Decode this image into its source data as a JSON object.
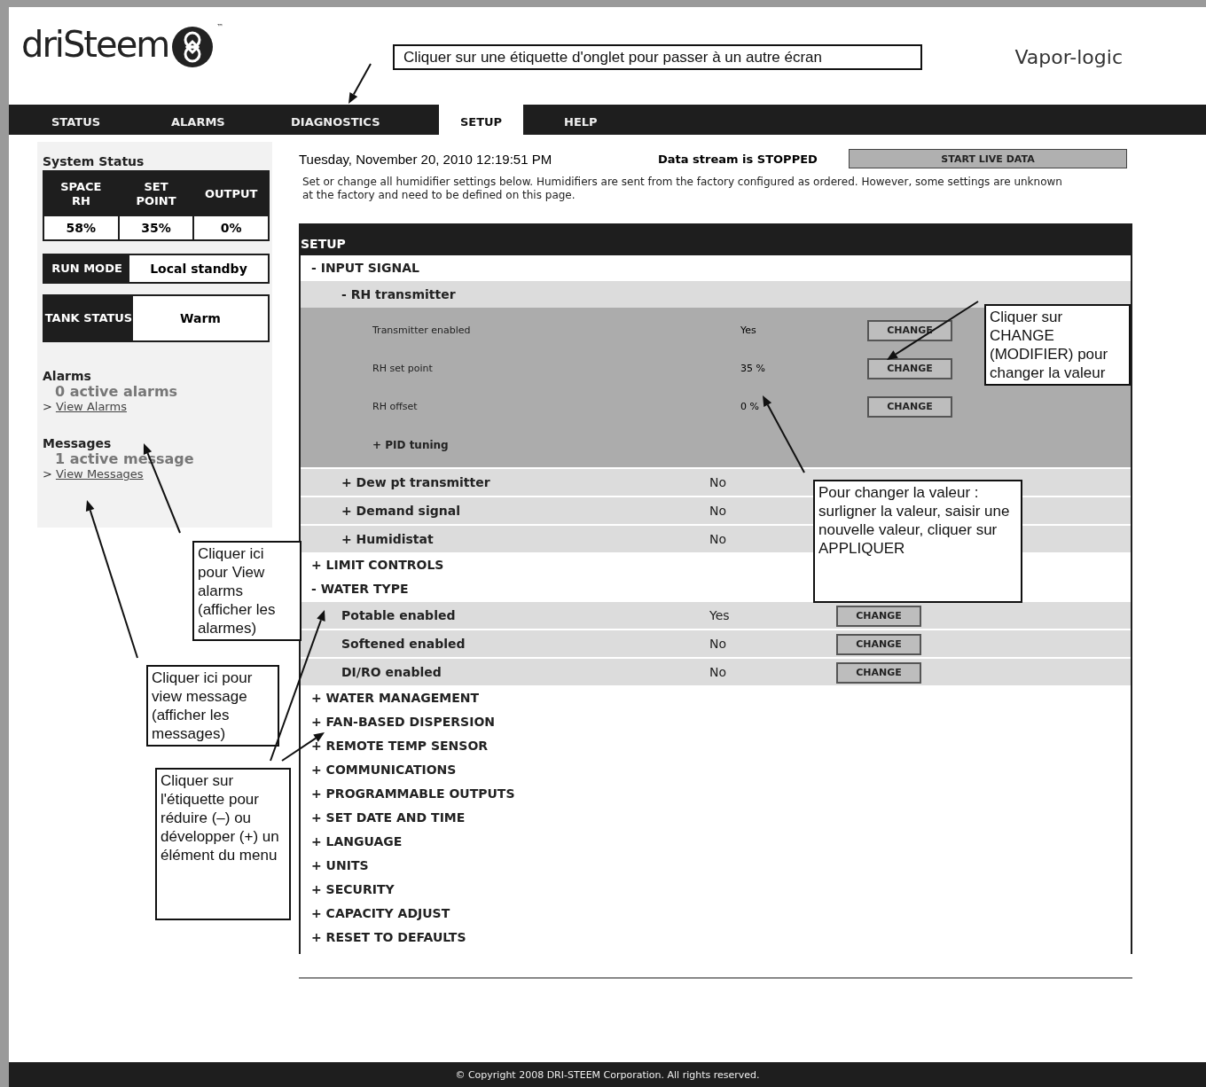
{
  "header": {
    "logo_text": "driSteem",
    "trademark": "™",
    "product": "Vapor-logic"
  },
  "tabs": [
    {
      "label": "STATUS",
      "selected": false
    },
    {
      "label": "ALARMS",
      "selected": false
    },
    {
      "label": "DIAGNOSTICS",
      "selected": false
    },
    {
      "label": "SETUP",
      "selected": true
    },
    {
      "label": "HELP",
      "selected": false
    }
  ],
  "sidebar": {
    "system_status": {
      "title": "System Status",
      "columns": [
        {
          "header": "SPACE RH",
          "value": "58%"
        },
        {
          "header": "SET POINT",
          "value": "35%"
        },
        {
          "header": "OUTPUT",
          "value": "0%"
        }
      ]
    },
    "run_mode": {
      "label": "RUN MODE",
      "value": "Local standby"
    },
    "tank_status": {
      "label": "TANK STATUS",
      "value": "Warm"
    },
    "alarms": {
      "title": "Alarms",
      "count": "0 active alarms",
      "link_prefix": ">",
      "link": "View Alarms"
    },
    "messages": {
      "title": "Messages",
      "count": "1 active message",
      "link_prefix": ">",
      "link": "View Messages"
    }
  },
  "main": {
    "datetime": "Tuesday, November 20, 2010  12:19:51 PM",
    "stream_status": "Data stream is STOPPED",
    "live_button": "START LIVE DATA",
    "description": "Set or change all humidifier settings below. Humidifiers are sent from the factory configured as ordered. However, some settings are unknown at the factory and need to be defined on this page.",
    "setup_title": "SETUP",
    "menu": [
      {
        "label": "- INPUT SIGNAL",
        "expanded": true,
        "children": [
          {
            "label": "- RH transmitter",
            "expanded": true,
            "children": [
              {
                "label": "Transmitter enabled",
                "value": "Yes",
                "button": "CHANGE"
              },
              {
                "label": "RH set point",
                "value": "35 %",
                "button": "CHANGE"
              },
              {
                "label": "RH offset",
                "value": "0 %",
                "button": "CHANGE"
              },
              {
                "label": "+ PID tuning",
                "expanded": false
              }
            ]
          },
          {
            "label": "+ Dew pt transmitter",
            "value": "No",
            "expanded": false
          },
          {
            "label": "+ Demand signal",
            "value": "No",
            "expanded": false
          },
          {
            "label": "+ Humidistat",
            "value": "No",
            "expanded": false
          }
        ]
      },
      {
        "label": "+ LIMIT CONTROLS",
        "expanded": false
      },
      {
        "label": "- WATER TYPE",
        "expanded": true,
        "children": [
          {
            "label": "Potable enabled",
            "value": "Yes",
            "button": "CHANGE"
          },
          {
            "label": "Softened enabled",
            "value": "No",
            "button": "CHANGE"
          },
          {
            "label": "DI/RO enabled",
            "value": "No",
            "button": "CHANGE"
          }
        ]
      },
      {
        "label": "+ WATER MANAGEMENT",
        "expanded": false
      },
      {
        "label": "+ FAN-BASED DISPERSION",
        "expanded": false
      },
      {
        "label": "+ REMOTE TEMP SENSOR",
        "expanded": false
      },
      {
        "label": "+ COMMUNICATIONS",
        "expanded": false
      },
      {
        "label": "+ PROGRAMMABLE OUTPUTS",
        "expanded": false
      },
      {
        "label": "+ SET DATE AND TIME",
        "expanded": false
      },
      {
        "label": "+ LANGUAGE",
        "expanded": false
      },
      {
        "label": "+ UNITS",
        "expanded": false
      },
      {
        "label": "+ SECURITY",
        "expanded": false
      },
      {
        "label": "+ CAPACITY ADJUST",
        "expanded": false
      },
      {
        "label": "+ RESET TO DEFAULTS",
        "expanded": false
      }
    ]
  },
  "footer": "© Copyright 2008 DRI-STEEM Corporation. All rights reserved.",
  "annotations": [
    {
      "text": "Cliquer sur une étiquette d'onglet pour passer à un autre écran"
    },
    {
      "text": "Cliquer sur CHANGE (MODIFIER) pour changer la valeur"
    },
    {
      "text": "Pour changer la valeur : surligner la valeur, saisir une nouvelle valeur, cliquer sur APPLIQUER"
    },
    {
      "text": "Cliquer ici pour View alarms (afficher les alarmes)"
    },
    {
      "text": "Cliquer ici pour view message (afficher les messages)"
    },
    {
      "text": "Cliquer sur l'étiquette pour réduire (–) ou développer (+) un élément du menu"
    }
  ]
}
